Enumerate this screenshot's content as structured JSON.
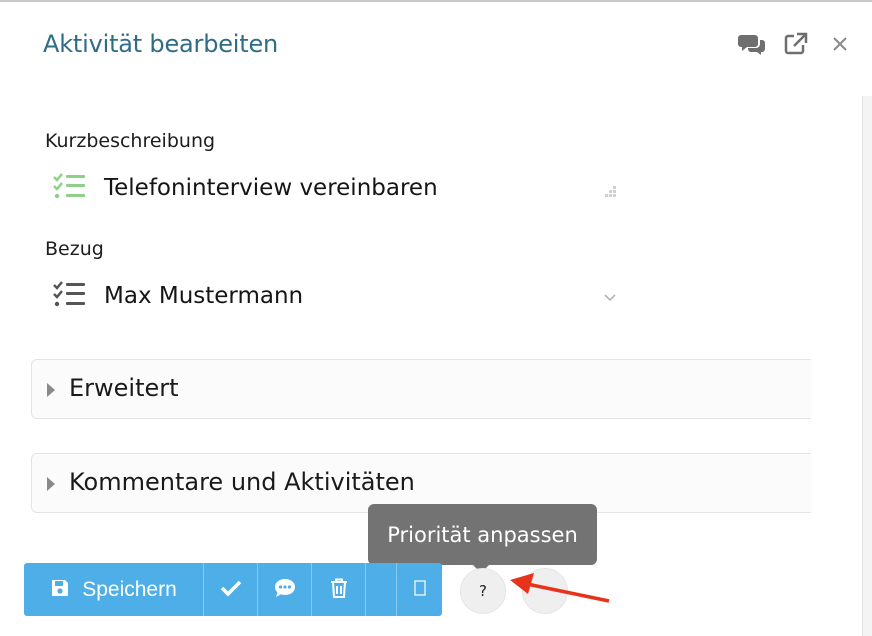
{
  "dialog": {
    "title": "Aktivität bearbeiten",
    "header_icons": [
      "comments-icon",
      "external-link-icon",
      "close-icon"
    ]
  },
  "form": {
    "short_description": {
      "label": "Kurzbeschreibung",
      "value": "Telefoninterview vereinbaren",
      "icon": "task-list-icon"
    },
    "reference": {
      "label": "Bezug",
      "value": "Max Mustermann",
      "icon": "task-list-icon"
    }
  },
  "sections": [
    {
      "label": "Erweitert",
      "expanded": false
    },
    {
      "label": "Kommentare und Aktivitäten",
      "expanded": false
    }
  ],
  "toolbar": {
    "save_label": "Speichern",
    "buttons": [
      "save-icon",
      "check-icon",
      "comment-icon",
      "trash-icon",
      "blank",
      "square-icon"
    ],
    "color": "#4eaee8"
  },
  "extra_buttons": {
    "priority_label": "?"
  },
  "tooltip": {
    "text": "Priorität anpassen"
  },
  "colors": {
    "title": "#2f6d86",
    "task_icon_active": "#8ed08a",
    "task_icon_default": "#555555",
    "tooltip_bg": "#737373",
    "annotation_arrow": "#e8331c"
  }
}
